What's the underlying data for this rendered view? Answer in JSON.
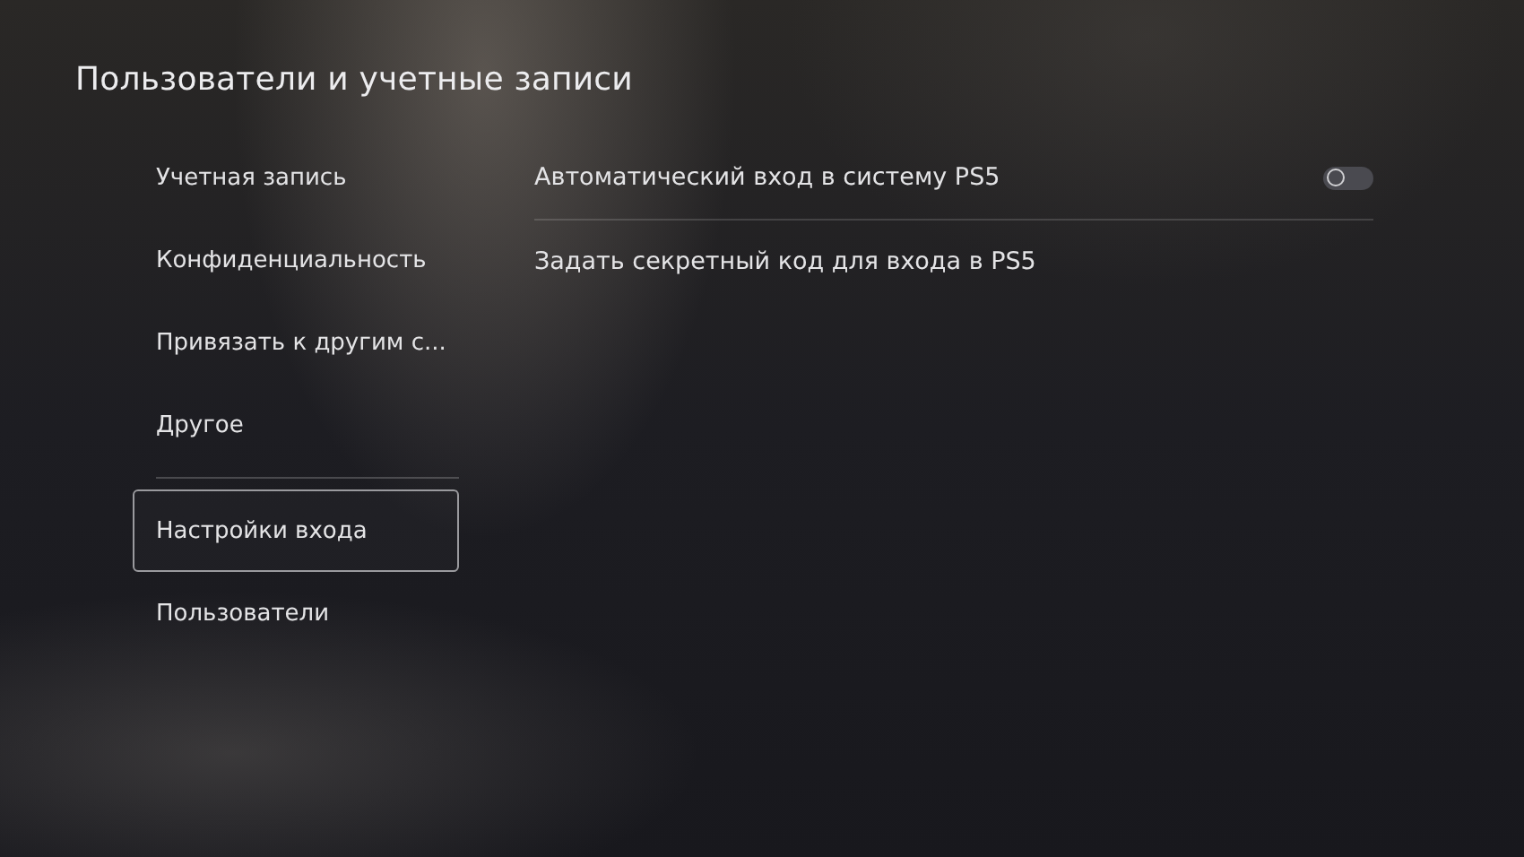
{
  "title": "Пользователи и учетные записи",
  "sidebar": {
    "groups": [
      {
        "items": [
          {
            "label": "Учетная запись",
            "selected": false
          },
          {
            "label": "Конфиденциальность",
            "selected": false
          },
          {
            "label": "Привязать к другим с...",
            "selected": false
          },
          {
            "label": "Другое",
            "selected": false
          }
        ]
      },
      {
        "items": [
          {
            "label": "Настройки входа",
            "selected": true
          },
          {
            "label": "Пользователи",
            "selected": false
          }
        ]
      }
    ]
  },
  "settings": [
    {
      "kind": "toggle",
      "label": "Автоматический вход в систему PS5",
      "on": false
    },
    {
      "kind": "link",
      "label": "Задать секретный код для входа в PS5"
    }
  ]
}
